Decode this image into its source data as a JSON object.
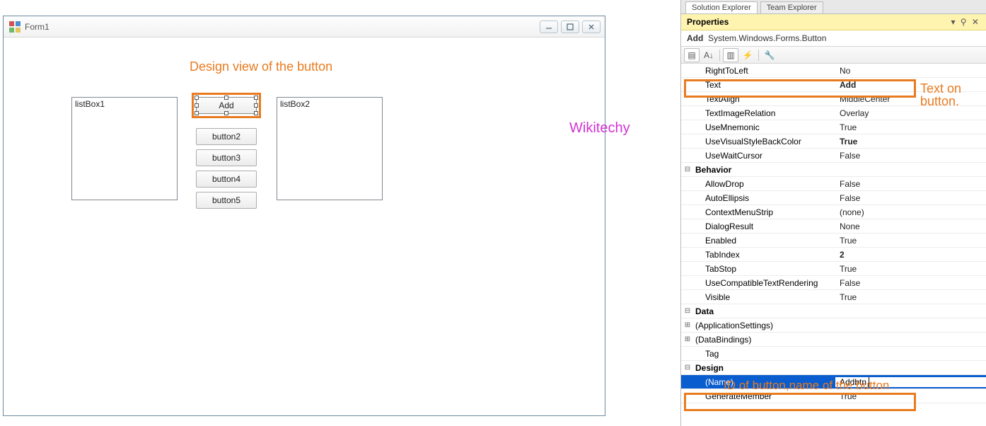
{
  "form": {
    "title": "Form1",
    "listbox1_text": "listBox1",
    "listbox2_text": "listBox2",
    "buttons": {
      "add": "Add",
      "b2": "button2",
      "b3": "button3",
      "b4": "button4",
      "b5": "button5"
    }
  },
  "annotations": {
    "design_view": "Design view of the button",
    "watermark": "Wikitechy",
    "text_on_button": "Text on button.",
    "id_label": "ID of button,name of the button"
  },
  "tabs": {
    "left": "Solution Explorer",
    "right": "Team Explorer"
  },
  "properties_panel": {
    "title": "Properties",
    "selected_name": "Add",
    "selected_type": "System.Windows.Forms.Button",
    "rows": [
      {
        "exp": "",
        "name": "RightToLeft",
        "val": "No",
        "indent": true
      },
      {
        "exp": "",
        "name": "Text",
        "val": "Add",
        "indent": true,
        "bold": true
      },
      {
        "exp": "",
        "name": "TextAlign",
        "val": "MiddleCenter",
        "indent": true
      },
      {
        "exp": "",
        "name": "TextImageRelation",
        "val": "Overlay",
        "indent": true
      },
      {
        "exp": "",
        "name": "UseMnemonic",
        "val": "True",
        "indent": true
      },
      {
        "exp": "",
        "name": "UseVisualStyleBackColor",
        "val": "True",
        "indent": true,
        "bold": true
      },
      {
        "exp": "",
        "name": "UseWaitCursor",
        "val": "False",
        "indent": true
      },
      {
        "exp": "⊟",
        "name": "Behavior",
        "val": "",
        "cat": true
      },
      {
        "exp": "",
        "name": "AllowDrop",
        "val": "False",
        "indent": true
      },
      {
        "exp": "",
        "name": "AutoEllipsis",
        "val": "False",
        "indent": true
      },
      {
        "exp": "",
        "name": "ContextMenuStrip",
        "val": "(none)",
        "indent": true
      },
      {
        "exp": "",
        "name": "DialogResult",
        "val": "None",
        "indent": true
      },
      {
        "exp": "",
        "name": "Enabled",
        "val": "True",
        "indent": true
      },
      {
        "exp": "",
        "name": "TabIndex",
        "val": "2",
        "indent": true,
        "bold": true
      },
      {
        "exp": "",
        "name": "TabStop",
        "val": "True",
        "indent": true
      },
      {
        "exp": "",
        "name": "UseCompatibleTextRendering",
        "val": "False",
        "indent": true
      },
      {
        "exp": "",
        "name": "Visible",
        "val": "True",
        "indent": true
      },
      {
        "exp": "⊟",
        "name": "Data",
        "val": "",
        "cat": true
      },
      {
        "exp": "⊞",
        "name": "(ApplicationSettings)",
        "val": "",
        "indent": false
      },
      {
        "exp": "⊞",
        "name": "(DataBindings)",
        "val": "",
        "indent": false
      },
      {
        "exp": "",
        "name": "Tag",
        "val": "",
        "indent": true
      },
      {
        "exp": "⊟",
        "name": "Design",
        "val": "",
        "cat": true
      },
      {
        "exp": "",
        "name": "(Name)",
        "val": "Addbtn",
        "indent": true,
        "selected": true
      },
      {
        "exp": "",
        "name": "GenerateMember",
        "val": "True",
        "indent": true
      }
    ]
  }
}
